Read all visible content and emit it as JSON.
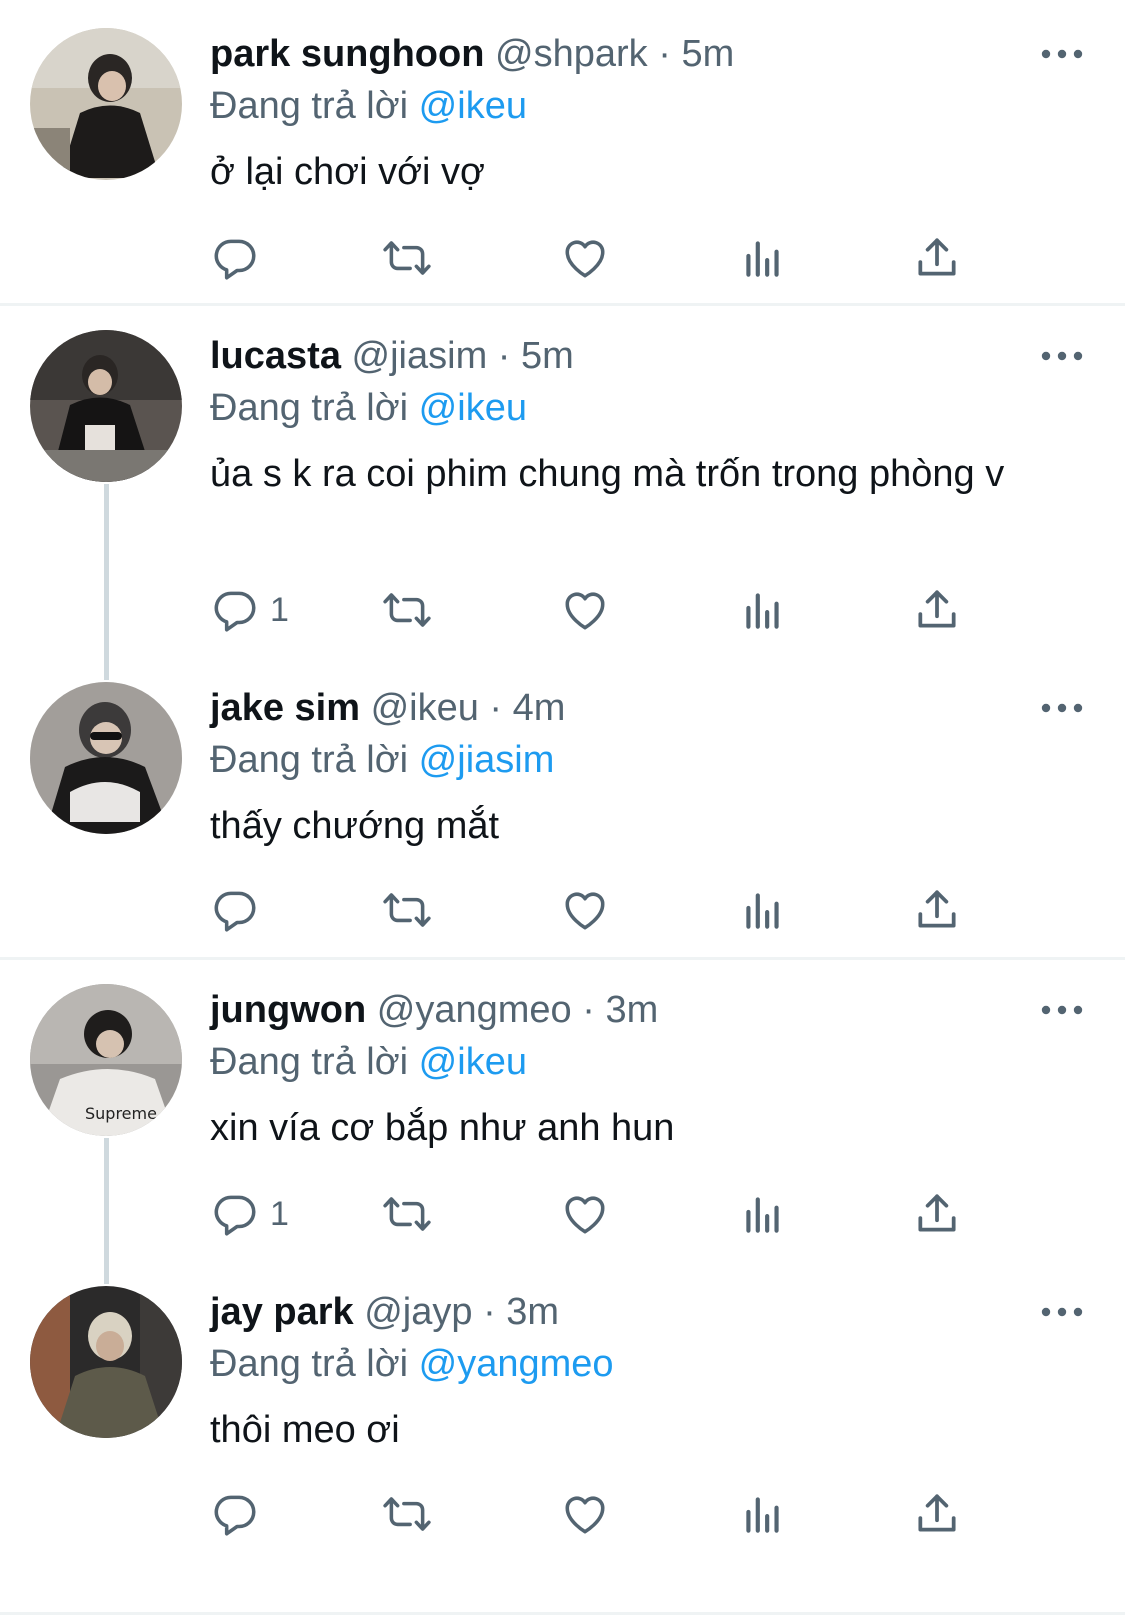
{
  "reply_prefix": "Đang trả lời",
  "colors": {
    "mention": "#1d9bf0",
    "secondary": "#536471",
    "line": "#cfd9de"
  },
  "tweets": [
    {
      "name": "park sunghoon",
      "handle": "@shpark",
      "sep": "·",
      "time": "5m",
      "reply_to": "@ikeu",
      "text": "ở lại chơi với vợ",
      "reply_count": ""
    },
    {
      "name": "lucasta",
      "handle": "@jiasim",
      "sep": "·",
      "time": "5m",
      "reply_to": "@ikeu",
      "text": "ủa s k ra coi phim chung mà trốn trong phòng v",
      "reply_count": "1"
    },
    {
      "name": "jake sim",
      "handle": "@ikeu",
      "sep": "·",
      "time": "4m",
      "reply_to": "@jiasim",
      "text": "thấy chướng mắt",
      "reply_count": ""
    },
    {
      "name": "jungwon",
      "handle": "@yangmeo",
      "sep": "·",
      "time": "3m",
      "reply_to": "@ikeu",
      "text": "xin vía cơ bắp như anh hun",
      "reply_count": "1"
    },
    {
      "name": "jay park",
      "handle": "@jayp",
      "sep": "·",
      "time": "3m",
      "reply_to": "@yangmeo",
      "text": "thôi meo ơi",
      "reply_count": ""
    }
  ],
  "icons": [
    "reply-icon",
    "retweet-icon",
    "like-icon",
    "views-icon",
    "share-icon",
    "more-icon"
  ]
}
